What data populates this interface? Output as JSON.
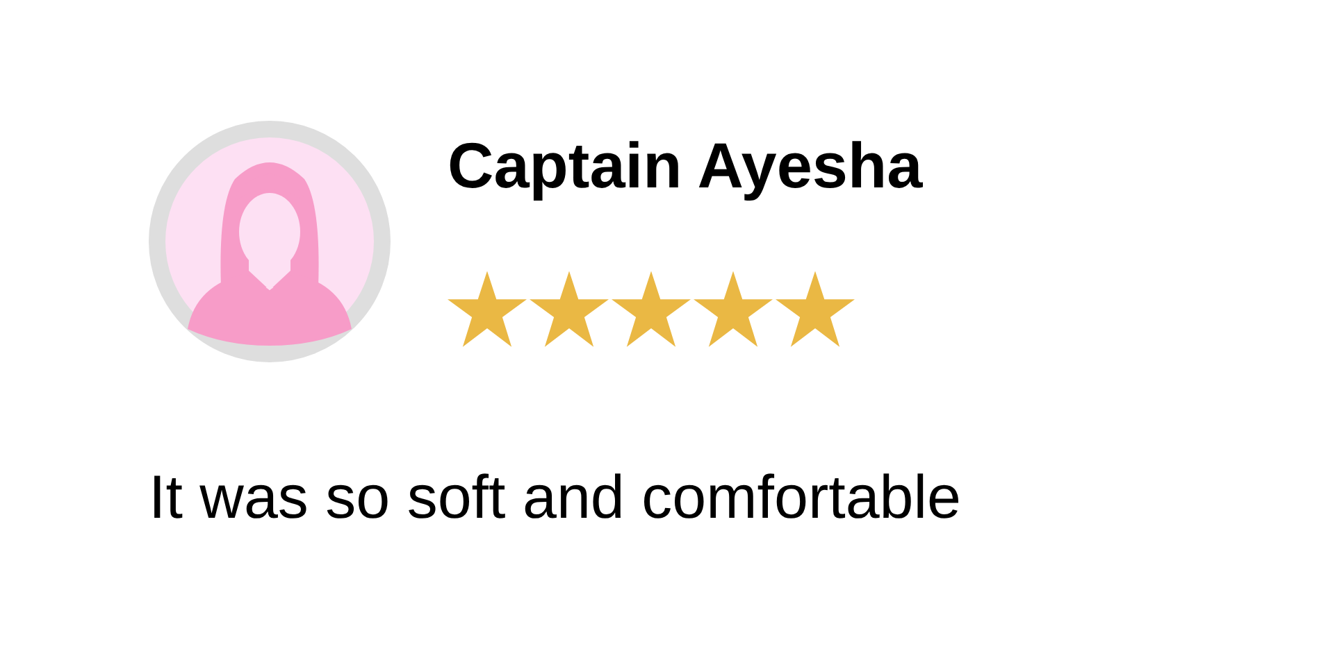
{
  "review": {
    "author": "Captain Ayesha",
    "stars": 5,
    "text": "It was so soft and comfortable"
  }
}
